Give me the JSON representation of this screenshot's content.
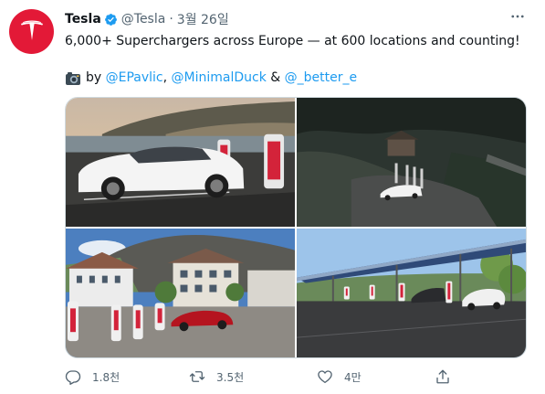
{
  "tweet": {
    "display_name": "Tesla",
    "handle": "@Tesla",
    "separator": "·",
    "date": "3월 26일",
    "text": "6,000+ Superchargers across Europe — at 600 locations and counting!",
    "credit": {
      "by": "by",
      "mention1": "@EPavlic",
      "comma1": ",",
      "mention2": "@MinimalDuck",
      "amp": "&",
      "mention3": "@_better_e"
    }
  },
  "icons": {
    "avatar": "tesla-logo",
    "verified": "verified-badge-icon",
    "more": "more-icon",
    "camera": "camera-emoji",
    "reply": "reply-icon",
    "retweet": "retweet-icon",
    "like": "like-icon",
    "share": "share-icon"
  },
  "colors": {
    "brand": "#e31937",
    "link": "#1d9bf0",
    "muted": "#536471"
  },
  "media": [
    {
      "description_name": "photo-white-tesla-lakeside"
    },
    {
      "description_name": "photo-night-supercharger-valley"
    },
    {
      "description_name": "photo-red-tesla-alpine-village"
    },
    {
      "description_name": "photo-solar-canopy-supercharger"
    }
  ],
  "actions": {
    "reply_count": "1.8천",
    "retweet_count": "3.5천",
    "like_count": "4만"
  }
}
